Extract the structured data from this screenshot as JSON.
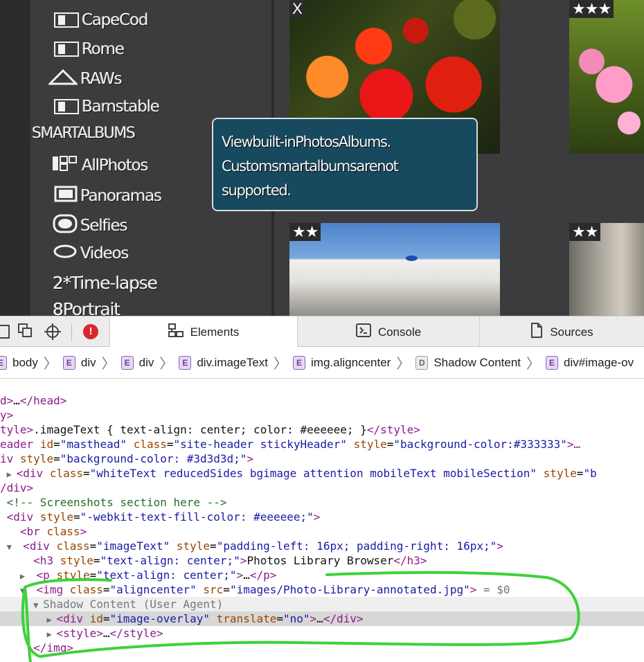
{
  "sidebar": {
    "items_top": [
      {
        "label": "CapeCod",
        "icon": "album-icon"
      },
      {
        "label": "Rome",
        "icon": "album-icon"
      },
      {
        "label": "RAWs",
        "icon": "raw-icon"
      },
      {
        "label": "Barnstable",
        "icon": "album-icon"
      }
    ],
    "heading": "SMARTALBUMS",
    "items_smart": [
      {
        "label": "AllPhotos",
        "icon": "all-photos-icon"
      },
      {
        "label": "Panoramas",
        "icon": "panorama-icon"
      },
      {
        "label": "Selfies",
        "icon": "selfie-icon"
      },
      {
        "label": "Videos",
        "icon": "video-icon"
      },
      {
        "label": "Time-lapse",
        "glyph": "2*"
      },
      {
        "label": "Portrait",
        "glyph": "8"
      }
    ]
  },
  "photos": [
    {
      "name": "flowers",
      "badge": "X"
    },
    {
      "name": "pink-flowers",
      "badge": "★★★"
    },
    {
      "name": "santorini",
      "badge": "★★"
    },
    {
      "name": "statue",
      "badge": "★★"
    }
  ],
  "tooltip": {
    "line1": "Viewbuilt-inPhotosAlbums.",
    "line2": "Customsmartalbumsarenot",
    "line3": "supported."
  },
  "devtools": {
    "tabs": {
      "elements": "Elements",
      "console": "Console",
      "sources": "Sources"
    },
    "breadcrumb": [
      {
        "badge": "E",
        "label": "body"
      },
      {
        "badge": "E",
        "label": "div"
      },
      {
        "badge": "E",
        "label": "div"
      },
      {
        "badge": "E",
        "label": "div.imageText"
      },
      {
        "badge": "E",
        "label": "img.aligncenter"
      },
      {
        "badge": "D",
        "label": "Shadow Content"
      },
      {
        "badge": "E",
        "label": "div#image-ov"
      }
    ],
    "tree": {
      "l1_tag": "d>",
      "l1_text": "…",
      "l1_close": "</head>",
      "l2_tag": "y>",
      "l3_tag": "tyle>",
      "l3_text": ".imageText { text-align: center; color: #eeeeee; }",
      "l3_close": "</style>",
      "l4_tag": "eader",
      "l4_a1": "id",
      "l4_v1": "\"masthead\"",
      "l4_a2": "class",
      "l4_v2": "\"site-header stickyHeader\"",
      "l4_a3": "style",
      "l4_v3": "\"background-color:#333333\"",
      "l4_end": ">…",
      "l5_tag": "iv",
      "l5_a1": "style",
      "l5_v1": "\"background-color: #3d3d3d;\"",
      "l5_end": ">",
      "l6_tag": "<div",
      "l6_a1": "class",
      "l6_v1": "\"whiteText reducedSides bgimage attention mobileText mobileSection\"",
      "l6_a2": "style",
      "l6_v2": "\"b",
      "l7_tag": "/div>",
      "l8_cmt": "<!-- Screenshots section here -->",
      "l9_tag": "<div",
      "l9_a1": "style",
      "l9_v1": "\"-webkit-text-fill-color: #eeeeee;\"",
      "l9_end": ">",
      "l10_tag": "<br",
      "l10_a1": "class",
      "l10_end": ">",
      "l11_tag": "<div",
      "l11_a1": "class",
      "l11_v1": "\"imageText\"",
      "l11_a2": "style",
      "l11_v2": "\"padding-left: 16px; padding-right: 16px;\"",
      "l11_end": ">",
      "l12_tag": "<h3",
      "l12_a1": "style",
      "l12_v1": "\"text-align: center;\"",
      "l12_text": "Photos Library Browser",
      "l12_close": "</h3>",
      "l13_tag": "<p",
      "l13_a1": "style",
      "l13_v1": "\"text-align: center;\"",
      "l13_text": "…",
      "l13_close": "</p>",
      "l14_tag": "<img",
      "l14_a1": "class",
      "l14_v1": "\"aligncenter\"",
      "l14_a2": "src",
      "l14_v2": "\"images/Photo-Library-annotated.jpg\"",
      "l14_end": ">",
      "l14_ref": " = $0",
      "l15_text": "Shadow Content (User Agent)",
      "l16_tag": "<div",
      "l16_a1": "id",
      "l16_v1": "\"image-overlay\"",
      "l16_a2": "translate",
      "l16_v2": "\"no\"",
      "l16_text": "…",
      "l16_close": "</div>",
      "l17_tag": "<style>",
      "l17_text": "…",
      "l17_close": "</style>",
      "l18_tag": "</img>"
    }
  },
  "colors": {
    "annotation": "#3ed13b",
    "tooltip_bg": "#17495f",
    "app_bg": "#3c3c3e"
  }
}
